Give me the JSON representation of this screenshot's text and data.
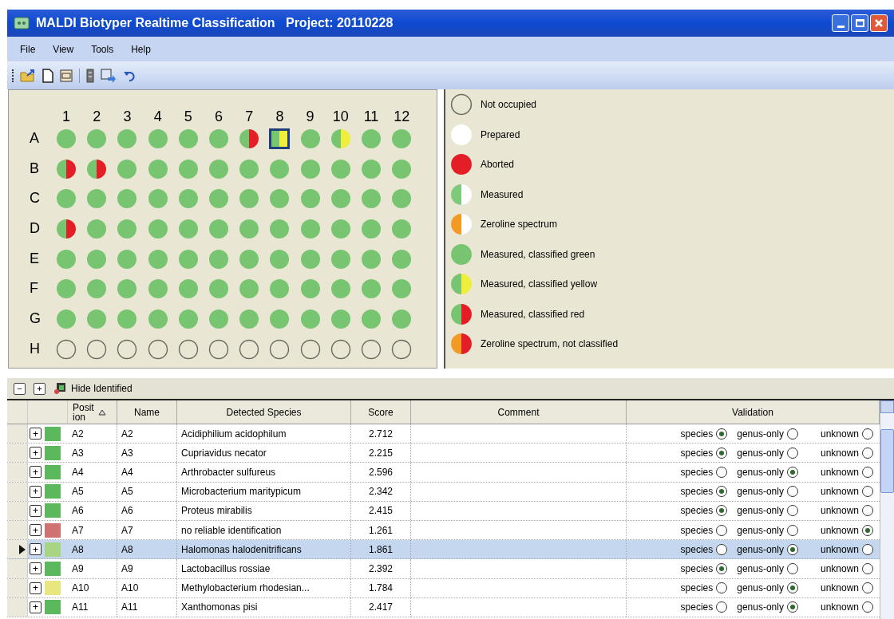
{
  "window": {
    "title": "MALDI Biotyper Realtime Classification   Project: 20110228"
  },
  "menu": [
    "File",
    "View",
    "Tools",
    "Help"
  ],
  "plate": {
    "column_labels": [
      "1",
      "2",
      "3",
      "4",
      "5",
      "6",
      "7",
      "8",
      "9",
      "10",
      "11",
      "12"
    ],
    "rows": [
      {
        "label": "A",
        "wells": [
          {
            "kind": "classified_green",
            "selected": false
          },
          {
            "kind": "classified_green",
            "selected": false
          },
          {
            "kind": "classified_green",
            "selected": false
          },
          {
            "kind": "classified_green",
            "selected": false
          },
          {
            "kind": "classified_green",
            "selected": false
          },
          {
            "kind": "classified_green",
            "selected": false
          },
          {
            "kind": "classified_red",
            "selected": false
          },
          {
            "kind": "classified_yellow",
            "selected": true
          },
          {
            "kind": "classified_green",
            "selected": false
          },
          {
            "kind": "classified_yellow",
            "selected": false
          },
          {
            "kind": "classified_green",
            "selected": false
          },
          {
            "kind": "classified_green",
            "selected": false
          }
        ]
      },
      {
        "label": "B",
        "wells": [
          {
            "kind": "classified_red",
            "selected": false
          },
          {
            "kind": "classified_red",
            "selected": false
          },
          {
            "kind": "classified_green",
            "selected": false
          },
          {
            "kind": "classified_green",
            "selected": false
          },
          {
            "kind": "classified_green",
            "selected": false
          },
          {
            "kind": "classified_green",
            "selected": false
          },
          {
            "kind": "classified_green",
            "selected": false
          },
          {
            "kind": "classified_green",
            "selected": false
          },
          {
            "kind": "classified_green",
            "selected": false
          },
          {
            "kind": "classified_green",
            "selected": false
          },
          {
            "kind": "classified_green",
            "selected": false
          },
          {
            "kind": "classified_green",
            "selected": false
          }
        ]
      },
      {
        "label": "C",
        "wells": [
          {
            "kind": "classified_green",
            "selected": false
          },
          {
            "kind": "classified_green",
            "selected": false
          },
          {
            "kind": "classified_green",
            "selected": false
          },
          {
            "kind": "classified_green",
            "selected": false
          },
          {
            "kind": "classified_green",
            "selected": false
          },
          {
            "kind": "classified_green",
            "selected": false
          },
          {
            "kind": "classified_green",
            "selected": false
          },
          {
            "kind": "classified_green",
            "selected": false
          },
          {
            "kind": "classified_green",
            "selected": false
          },
          {
            "kind": "classified_green",
            "selected": false
          },
          {
            "kind": "classified_green",
            "selected": false
          },
          {
            "kind": "classified_green",
            "selected": false
          }
        ]
      },
      {
        "label": "D",
        "wells": [
          {
            "kind": "classified_red",
            "selected": false
          },
          {
            "kind": "classified_green",
            "selected": false
          },
          {
            "kind": "classified_green",
            "selected": false
          },
          {
            "kind": "classified_green",
            "selected": false
          },
          {
            "kind": "classified_green",
            "selected": false
          },
          {
            "kind": "classified_green",
            "selected": false
          },
          {
            "kind": "classified_green",
            "selected": false
          },
          {
            "kind": "classified_green",
            "selected": false
          },
          {
            "kind": "classified_green",
            "selected": false
          },
          {
            "kind": "classified_green",
            "selected": false
          },
          {
            "kind": "classified_green",
            "selected": false
          },
          {
            "kind": "classified_green",
            "selected": false
          }
        ]
      },
      {
        "label": "E",
        "wells": [
          {
            "kind": "classified_green",
            "selected": false
          },
          {
            "kind": "classified_green",
            "selected": false
          },
          {
            "kind": "classified_green",
            "selected": false
          },
          {
            "kind": "classified_green",
            "selected": false
          },
          {
            "kind": "classified_green",
            "selected": false
          },
          {
            "kind": "classified_green",
            "selected": false
          },
          {
            "kind": "classified_green",
            "selected": false
          },
          {
            "kind": "classified_green",
            "selected": false
          },
          {
            "kind": "classified_green",
            "selected": false
          },
          {
            "kind": "classified_green",
            "selected": false
          },
          {
            "kind": "classified_green",
            "selected": false
          },
          {
            "kind": "classified_green",
            "selected": false
          }
        ]
      },
      {
        "label": "F",
        "wells": [
          {
            "kind": "classified_green",
            "selected": false
          },
          {
            "kind": "classified_green",
            "selected": false
          },
          {
            "kind": "classified_green",
            "selected": false
          },
          {
            "kind": "classified_green",
            "selected": false
          },
          {
            "kind": "classified_green",
            "selected": false
          },
          {
            "kind": "classified_green",
            "selected": false
          },
          {
            "kind": "classified_green",
            "selected": false
          },
          {
            "kind": "classified_green",
            "selected": false
          },
          {
            "kind": "classified_green",
            "selected": false
          },
          {
            "kind": "classified_green",
            "selected": false
          },
          {
            "kind": "classified_green",
            "selected": false
          },
          {
            "kind": "classified_green",
            "selected": false
          }
        ]
      },
      {
        "label": "G",
        "wells": [
          {
            "kind": "classified_green",
            "selected": false
          },
          {
            "kind": "classified_green",
            "selected": false
          },
          {
            "kind": "classified_green",
            "selected": false
          },
          {
            "kind": "classified_green",
            "selected": false
          },
          {
            "kind": "classified_green",
            "selected": false
          },
          {
            "kind": "classified_green",
            "selected": false
          },
          {
            "kind": "classified_green",
            "selected": false
          },
          {
            "kind": "classified_green",
            "selected": false
          },
          {
            "kind": "classified_green",
            "selected": false
          },
          {
            "kind": "classified_green",
            "selected": false
          },
          {
            "kind": "classified_green",
            "selected": false
          },
          {
            "kind": "classified_green",
            "selected": false
          }
        ]
      },
      {
        "label": "H",
        "wells": [
          {
            "kind": "not_occupied",
            "selected": false
          },
          {
            "kind": "not_occupied",
            "selected": false
          },
          {
            "kind": "not_occupied",
            "selected": false
          },
          {
            "kind": "not_occupied",
            "selected": false
          },
          {
            "kind": "not_occupied",
            "selected": false
          },
          {
            "kind": "not_occupied",
            "selected": false
          },
          {
            "kind": "not_occupied",
            "selected": false
          },
          {
            "kind": "not_occupied",
            "selected": false
          },
          {
            "kind": "not_occupied",
            "selected": false
          },
          {
            "kind": "not_occupied",
            "selected": false
          },
          {
            "kind": "not_occupied",
            "selected": false
          },
          {
            "kind": "not_occupied",
            "selected": false
          }
        ]
      }
    ]
  },
  "legend": [
    {
      "kind": "not_occupied",
      "label": "Not occupied"
    },
    {
      "kind": "prepared",
      "label": "Prepared"
    },
    {
      "kind": "aborted",
      "label": "Aborted"
    },
    {
      "kind": "measured",
      "label": "Measured"
    },
    {
      "kind": "zeroline",
      "label": "Zeroline spectrum"
    },
    {
      "kind": "classified_green",
      "label": "Measured, classified green"
    },
    {
      "kind": "classified_yellow",
      "label": "Measured, classified yellow"
    },
    {
      "kind": "classified_red",
      "label": "Measured, classified red"
    },
    {
      "kind": "zeroline_not_classified",
      "label": "Zeroline spectrum, not classified"
    }
  ],
  "results_toolbar": {
    "collapse": "−",
    "expand": "+",
    "hide_label": "Hide Identified"
  },
  "table": {
    "columns": [
      "Position",
      "Name",
      "Detected Species",
      "Score",
      "Comment",
      "Validation"
    ],
    "rows": [
      {
        "selected": false,
        "expander": "+",
        "color": "#5cb85c",
        "position": "A2",
        "name": "A2",
        "species": "Acidiphilium acidophilum",
        "score": "2.712",
        "validation": [
          {
            "label": "species",
            "selected": true
          },
          {
            "label": "genus-only",
            "selected": false
          },
          {
            "label": "unknown",
            "selected": false
          }
        ]
      },
      {
        "selected": false,
        "expander": "+",
        "color": "#5cb85c",
        "position": "A3",
        "name": "A3",
        "species": "Cupriavidus necator",
        "score": "2.215",
        "validation": [
          {
            "label": "species",
            "selected": true
          },
          {
            "label": "genus-only",
            "selected": false
          },
          {
            "label": "unknown",
            "selected": false
          }
        ]
      },
      {
        "selected": false,
        "expander": "+",
        "color": "#5cb85c",
        "position": "A4",
        "name": "A4",
        "species": "Arthrobacter sulfureus",
        "score": "2.596",
        "validation": [
          {
            "label": "species",
            "selected": false
          },
          {
            "label": "genus-only",
            "selected": true
          },
          {
            "label": "unknown",
            "selected": false
          }
        ]
      },
      {
        "selected": false,
        "expander": "+",
        "color": "#5cb85c",
        "position": "A5",
        "name": "A5",
        "species": "Microbacterium maritypicum",
        "score": "2.342",
        "validation": [
          {
            "label": "species",
            "selected": true
          },
          {
            "label": "genus-only",
            "selected": false
          },
          {
            "label": "unknown",
            "selected": false
          }
        ]
      },
      {
        "selected": false,
        "expander": "+",
        "color": "#5cb85c",
        "position": "A6",
        "name": "A6",
        "species": "Proteus mirabilis",
        "score": "2.415",
        "validation": [
          {
            "label": "species",
            "selected": true
          },
          {
            "label": "genus-only",
            "selected": false
          },
          {
            "label": "unknown",
            "selected": false
          }
        ]
      },
      {
        "selected": false,
        "expander": "+",
        "color": "#d07272",
        "position": "A7",
        "name": "A7",
        "species": "no reliable identification",
        "score": "1.261",
        "validation": [
          {
            "label": "species",
            "selected": false
          },
          {
            "label": "genus-only",
            "selected": false
          },
          {
            "label": "unknown",
            "selected": true
          }
        ]
      },
      {
        "selected": true,
        "expander": "+",
        "color": "#a8d582",
        "position": "A8",
        "name": "A8",
        "species": "Halomonas halodenitrificans",
        "score": "1.861",
        "validation": [
          {
            "label": "species",
            "selected": false
          },
          {
            "label": "genus-only",
            "selected": true
          },
          {
            "label": "unknown",
            "selected": false
          }
        ]
      },
      {
        "selected": false,
        "expander": "+",
        "color": "#5cb85c",
        "position": "A9",
        "name": "A9",
        "species": "Lactobacillus rossiae",
        "score": "2.392",
        "validation": [
          {
            "label": "species",
            "selected": true
          },
          {
            "label": "genus-only",
            "selected": false
          },
          {
            "label": "unknown",
            "selected": false
          }
        ]
      },
      {
        "selected": false,
        "expander": "+",
        "color": "#e8e67e",
        "position": "A10",
        "name": "A10",
        "species": "Methylobacterium rhodesian...",
        "score": "1.784",
        "validation": [
          {
            "label": "species",
            "selected": false
          },
          {
            "label": "genus-only",
            "selected": true
          },
          {
            "label": "unknown",
            "selected": false
          }
        ]
      },
      {
        "selected": false,
        "expander": "+",
        "color": "#5cb85c",
        "position": "A11",
        "name": "A11",
        "species": "Xanthomonas pisi",
        "score": "2.417",
        "validation": [
          {
            "label": "species",
            "selected": false
          },
          {
            "label": "genus-only",
            "selected": true
          },
          {
            "label": "unknown",
            "selected": false
          }
        ]
      }
    ]
  }
}
